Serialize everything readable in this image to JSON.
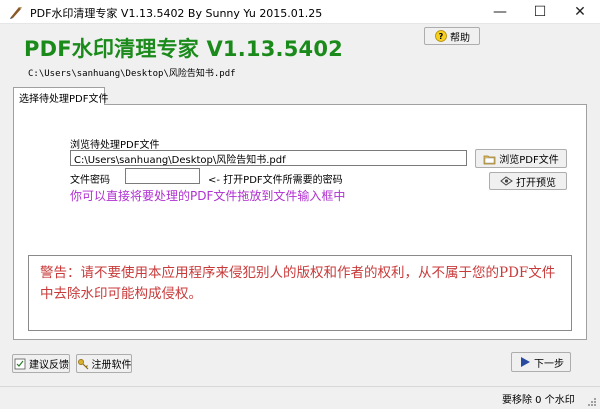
{
  "window": {
    "title": "PDF水印清理专家 V1.13.5402 By Sunny Yu 2015.01.25",
    "minimize_glyph": "—",
    "maximize_glyph": "☐",
    "close_glyph": "✕",
    "app_icon": "pen-nib-icon"
  },
  "header": {
    "app_name": "PDF水印清理专家 V1.13.5402",
    "current_path": "C:\\Users\\sanhuang\\Desktop\\风险告知书.pdf",
    "help_label": "帮助",
    "help_icon": "question-icon"
  },
  "tabs": [
    {
      "label": "选择待处理PDF文件",
      "active": true
    }
  ],
  "form": {
    "browse_label": "浏览待处理PDF文件",
    "file_value": "C:\\Users\\sanhuang\\Desktop\\风险告知书.pdf",
    "browse_button_label": "浏览PDF文件",
    "password_label": "文件密码",
    "password_value": "",
    "password_hint": "<- 打开PDF文件所需要的密码",
    "preview_button_label": "打开预览",
    "drag_hint": "你可以直接将要处理的PDF文件拖放到文件输入框中"
  },
  "warning": {
    "text": "警告：请不要使用本应用程序来侵犯别人的版权和作者的权利，从不属于您的PDF文件中去除水印可能构成侵权。"
  },
  "footer": {
    "feedback_label": "建议反馈",
    "register_label": "注册软件",
    "next_label": "下一步"
  },
  "status": {
    "text": "要移除 0 个水印"
  },
  "colors": {
    "heading_green": "#1a8a1a",
    "hint_purple": "#b030d0",
    "warning_red": "#c83a3a",
    "window_bg": "#f0f0f0"
  }
}
